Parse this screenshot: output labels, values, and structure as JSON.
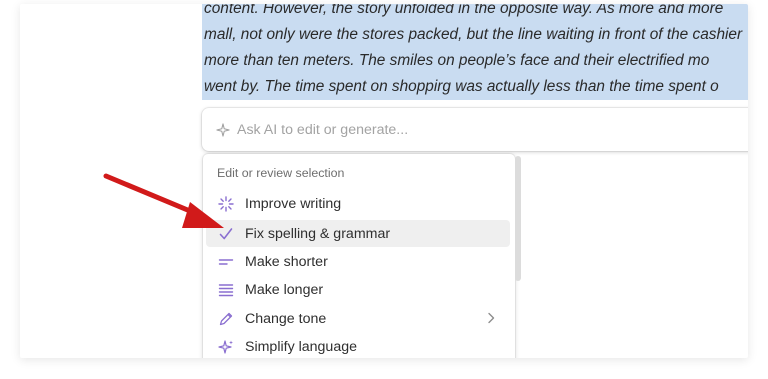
{
  "document": {
    "lines": [
      "content. However, the story unfolded in the opposite way. As more and more",
      "mall, not only were the stores packed, but the line waiting in front of the cashier",
      "more than ten meters. The smiles on people’s face and their electrified mo",
      "went by. The time spent on shoppirg was actually less than the time spent o"
    ]
  },
  "ai_bar": {
    "placeholder": "Ask AI to edit or generate...",
    "icon": "sparkle-icon"
  },
  "menu": {
    "heading": "Edit or review selection",
    "items": [
      {
        "label": "Improve writing",
        "icon": "sparkle-burst-icon"
      },
      {
        "label": "Fix spelling & grammar",
        "icon": "check-icon",
        "selected": true
      },
      {
        "label": "Make shorter",
        "icon": "short-lines-icon"
      },
      {
        "label": "Make longer",
        "icon": "long-lines-icon"
      },
      {
        "label": "Change tone",
        "icon": "pen-icon",
        "has_submenu": true
      },
      {
        "label": "Simplify language",
        "icon": "sparkle-icon"
      }
    ]
  },
  "colors": {
    "selection_highlight": "#c9dcf1",
    "icon_accent": "#8a6fd0",
    "annotation_arrow": "#d11a1a",
    "hover_row": "#efefef"
  }
}
